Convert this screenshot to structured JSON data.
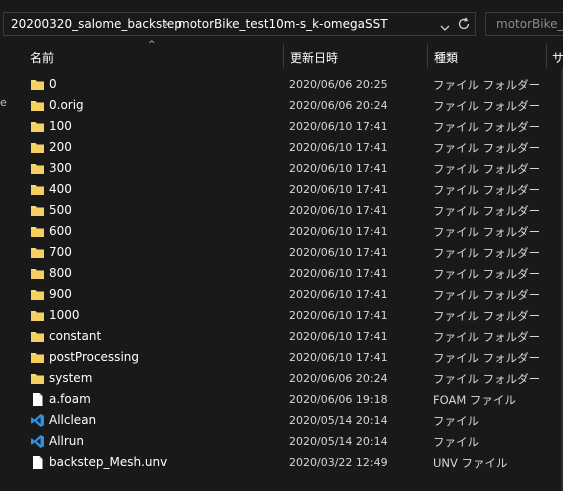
{
  "breadcrumb": {
    "items": [
      "20200320_salome_backstep",
      "motorBike_test10m-s_k-omegaSST"
    ]
  },
  "search": {
    "placeholder": "motorBike_te"
  },
  "columns": {
    "name": "名前",
    "date": "更新日時",
    "type": "種類",
    "size": "サ"
  },
  "left_edge_text": "e",
  "files": [
    {
      "name": "0",
      "date": "2020/06/06 20:25",
      "type": "ファイル フォルダー",
      "icon": "folder-icon"
    },
    {
      "name": "0.orig",
      "date": "2020/06/06 20:24",
      "type": "ファイル フォルダー",
      "icon": "folder-icon"
    },
    {
      "name": "100",
      "date": "2020/06/10 17:41",
      "type": "ファイル フォルダー",
      "icon": "folder-icon"
    },
    {
      "name": "200",
      "date": "2020/06/10 17:41",
      "type": "ファイル フォルダー",
      "icon": "folder-icon"
    },
    {
      "name": "300",
      "date": "2020/06/10 17:41",
      "type": "ファイル フォルダー",
      "icon": "folder-icon"
    },
    {
      "name": "400",
      "date": "2020/06/10 17:41",
      "type": "ファイル フォルダー",
      "icon": "folder-icon"
    },
    {
      "name": "500",
      "date": "2020/06/10 17:41",
      "type": "ファイル フォルダー",
      "icon": "folder-icon"
    },
    {
      "name": "600",
      "date": "2020/06/10 17:41",
      "type": "ファイル フォルダー",
      "icon": "folder-icon"
    },
    {
      "name": "700",
      "date": "2020/06/10 17:41",
      "type": "ファイル フォルダー",
      "icon": "folder-icon"
    },
    {
      "name": "800",
      "date": "2020/06/10 17:41",
      "type": "ファイル フォルダー",
      "icon": "folder-icon"
    },
    {
      "name": "900",
      "date": "2020/06/10 17:41",
      "type": "ファイル フォルダー",
      "icon": "folder-icon"
    },
    {
      "name": "1000",
      "date": "2020/06/10 17:41",
      "type": "ファイル フォルダー",
      "icon": "folder-icon"
    },
    {
      "name": "constant",
      "date": "2020/06/10 17:41",
      "type": "ファイル フォルダー",
      "icon": "folder-icon"
    },
    {
      "name": "postProcessing",
      "date": "2020/06/10 17:41",
      "type": "ファイル フォルダー",
      "icon": "folder-icon"
    },
    {
      "name": "system",
      "date": "2020/06/06 20:24",
      "type": "ファイル フォルダー",
      "icon": "folder-icon"
    },
    {
      "name": "a.foam",
      "date": "2020/06/06 19:18",
      "type": "FOAM ファイル",
      "icon": "document-icon"
    },
    {
      "name": "Allclean",
      "date": "2020/05/14 20:14",
      "type": "ファイル",
      "icon": "vscode-icon"
    },
    {
      "name": "Allrun",
      "date": "2020/05/14 20:14",
      "type": "ファイル",
      "icon": "vscode-icon"
    },
    {
      "name": "backstep_Mesh.unv",
      "date": "2020/03/22 12:49",
      "type": "UNV ファイル",
      "icon": "document-icon"
    }
  ],
  "colors": {
    "background": "#191919",
    "folder": "#f8d775",
    "vscode": "#2f8fe0",
    "text": "#ffffff",
    "subtext": "#d6d6d6"
  }
}
